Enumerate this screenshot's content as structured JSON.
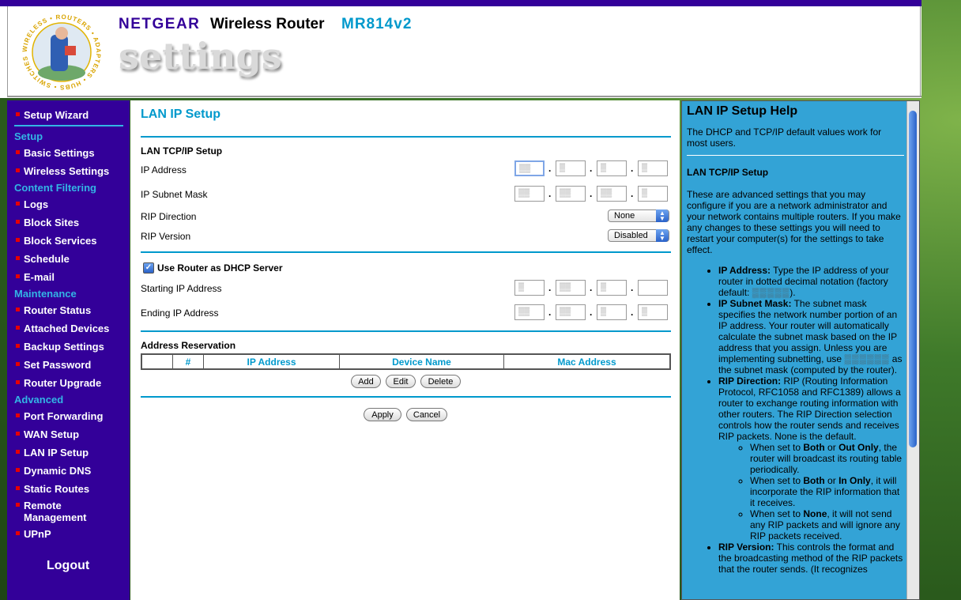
{
  "header": {
    "brand": "NETGEAR",
    "product": "Wireless Router",
    "model": "MR814v2",
    "settings_word": "settings",
    "logo_ring_text": "WIRELESS • ROUTERS • ADAPTERS • HUBS • SWITCHES •"
  },
  "sidebar": {
    "items": [
      {
        "label": "Setup Wizard"
      },
      {
        "label": "Setup"
      },
      {
        "label": "Basic Settings"
      },
      {
        "label": "Wireless Settings"
      },
      {
        "label": "Content Filtering"
      },
      {
        "label": "Logs"
      },
      {
        "label": "Block Sites"
      },
      {
        "label": "Block Services"
      },
      {
        "label": "Schedule"
      },
      {
        "label": "E-mail"
      },
      {
        "label": "Maintenance"
      },
      {
        "label": "Router Status"
      },
      {
        "label": "Attached Devices"
      },
      {
        "label": "Backup Settings"
      },
      {
        "label": "Set Password"
      },
      {
        "label": "Router Upgrade"
      },
      {
        "label": "Advanced"
      },
      {
        "label": "Port Forwarding"
      },
      {
        "label": "WAN Setup"
      },
      {
        "label": "LAN IP Setup"
      },
      {
        "label": "Dynamic DNS"
      },
      {
        "label": "Static Routes"
      },
      {
        "label": "Remote"
      },
      {
        "label": "Management"
      },
      {
        "label": "UPnP"
      }
    ],
    "logout": "Logout"
  },
  "main": {
    "title": "LAN IP Setup",
    "lan_section": "LAN TCP/IP Setup",
    "ip_address_label": "IP Address",
    "subnet_label": "IP Subnet Mask",
    "rip_direction_label": "RIP Direction",
    "rip_direction_value": "None",
    "rip_version_label": "RIP Version",
    "rip_version_value": "Disabled",
    "dhcp_label": "Use Router as DHCP Server",
    "dhcp_checked": true,
    "start_ip_label": "Starting IP Address",
    "end_ip_label": "Ending IP Address",
    "reservation_title": "Address Reservation",
    "table_headers": [
      "",
      "#",
      "IP Address",
      "Device Name",
      "Mac Address"
    ],
    "buttons": {
      "add": "Add",
      "edit": "Edit",
      "delete": "Delete",
      "apply": "Apply",
      "cancel": "Cancel"
    }
  },
  "help": {
    "title": "LAN IP Setup Help",
    "intro": "The DHCP and TCP/IP default values work for most users.",
    "section": "LAN TCP/IP Setup",
    "para": "These are advanced settings that you may configure if you are a network administrator and your network contains multiple routers. If you make any changes to these settings you will need to restart your computer(s) for the settings to take effect.",
    "ip_title": "IP Address:",
    "ip_text": "Type the IP address of your router in dotted decimal notation (factory default:",
    "ip_tail": ").",
    "subnet_title": "IP Subnet Mask:",
    "subnet_text": "The subnet mask specifies the network number portion of an IP address. Your router will automatically calculate the subnet mask based on the IP address that you assign. Unless you are implementing subnetting, use",
    "subnet_tail": "as the subnet mask (computed by the router).",
    "rip_dir_title": "RIP Direction:",
    "rip_dir_text": "RIP (Routing Information Protocol, RFC1058 and RFC1389) allows a router to exchange routing information with other routers. The RIP Direction selection controls how the router sends and receives RIP packets. None is the default.",
    "sub1_a": "When set to",
    "sub1_b": "Both",
    "sub1_c": "or",
    "sub1_d": "Out Only",
    "sub1_e": ", the router will broadcast its routing table periodically.",
    "sub2_a": "When set to",
    "sub2_b": "Both",
    "sub2_c": "or",
    "sub2_d": "In Only",
    "sub2_e": ", it will incorporate the RIP information that it receives.",
    "sub3_a": "When set to",
    "sub3_b": "None",
    "sub3_c": ", it will not send any RIP packets and will ignore any RIP packets received.",
    "rip_ver_title": "RIP Version:",
    "rip_ver_text": "This controls the format and the broadcasting method of the RIP packets that the router sends. (It recognizes"
  }
}
